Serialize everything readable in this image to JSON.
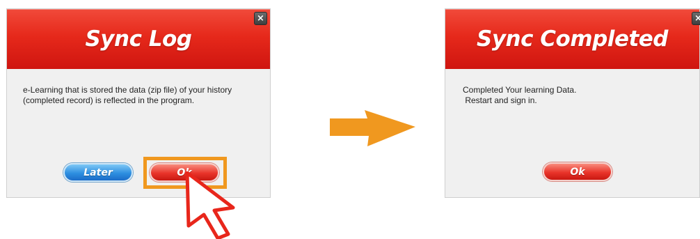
{
  "sync_log_dialog": {
    "title": "Sync Log",
    "message_lines": [
      "e-Learning that is stored the data (zip file) of your history",
      "(completed record) is reflected in the program."
    ],
    "close_glyph": "×",
    "later_label": "Later",
    "ok_label": "Ok"
  },
  "sync_completed_dialog": {
    "title": "Sync Completed",
    "message_lines": [
      "Completed Your learning Data.",
      " Restart and sign in."
    ],
    "close_glyph": "×",
    "ok_label": "Ok"
  },
  "annotations": {
    "highlight_color": "#f0981f",
    "arrow_color": "#f0981f",
    "cursor_color": "#e8261b",
    "cursor_icon": "hand-pointer-icon"
  },
  "colors": {
    "header_red": "#e6291b",
    "button_blue": "#2e8fe0",
    "button_red": "#e9342a",
    "dialog_body": "#f0f0f0"
  }
}
